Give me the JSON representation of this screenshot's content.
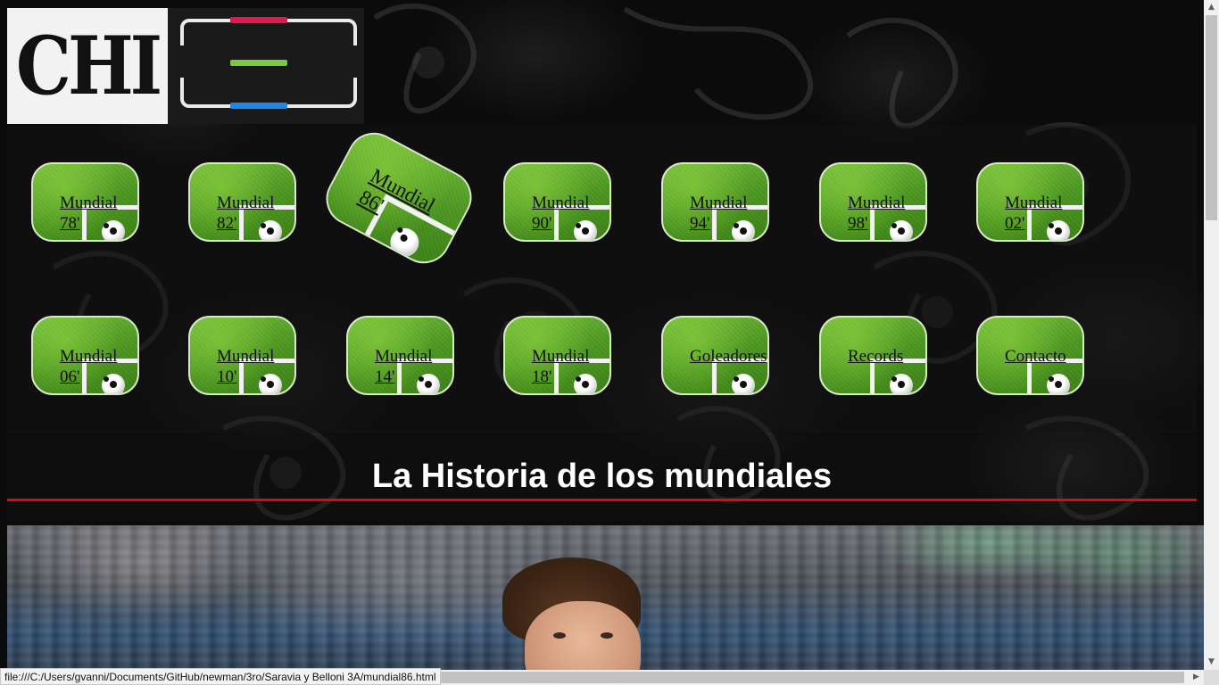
{
  "logo": {
    "text": "CHI",
    "bar_colors": [
      "#e01a4f",
      "#7ac943",
      "#1e88e5"
    ]
  },
  "nav": {
    "row1": [
      {
        "label": "Mundial\n78'"
      },
      {
        "label": "Mundial\n82'"
      },
      {
        "label": "Mundial\n86'"
      },
      {
        "label": "Mundial\n90'"
      },
      {
        "label": "Mundial\n94'"
      },
      {
        "label": "Mundial\n98'"
      },
      {
        "label": "Mundial\n02'"
      }
    ],
    "row2": [
      {
        "label": "Mundial\n06'"
      },
      {
        "label": "Mundial\n10'"
      },
      {
        "label": "Mundial\n14'"
      },
      {
        "label": "Mundial\n18'"
      },
      {
        "label": "Goleadores"
      },
      {
        "label": "Records"
      },
      {
        "label": "Contacto"
      }
    ]
  },
  "main": {
    "heading": "La Historia de los mundiales",
    "rule_color": "#d90c0c",
    "hero_image": "player-photo"
  },
  "status_bar": {
    "url": "file:///C:/Users/gvanni/Documents/GitHub/newman/3ro/Saravia y Belloni 3A/mundial86.html"
  },
  "scrollbars": {
    "up_icon": "chevron-up-icon",
    "down_icon": "chevron-down-icon",
    "left_icon": "chevron-left-icon",
    "right_icon": "chevron-right-icon"
  }
}
